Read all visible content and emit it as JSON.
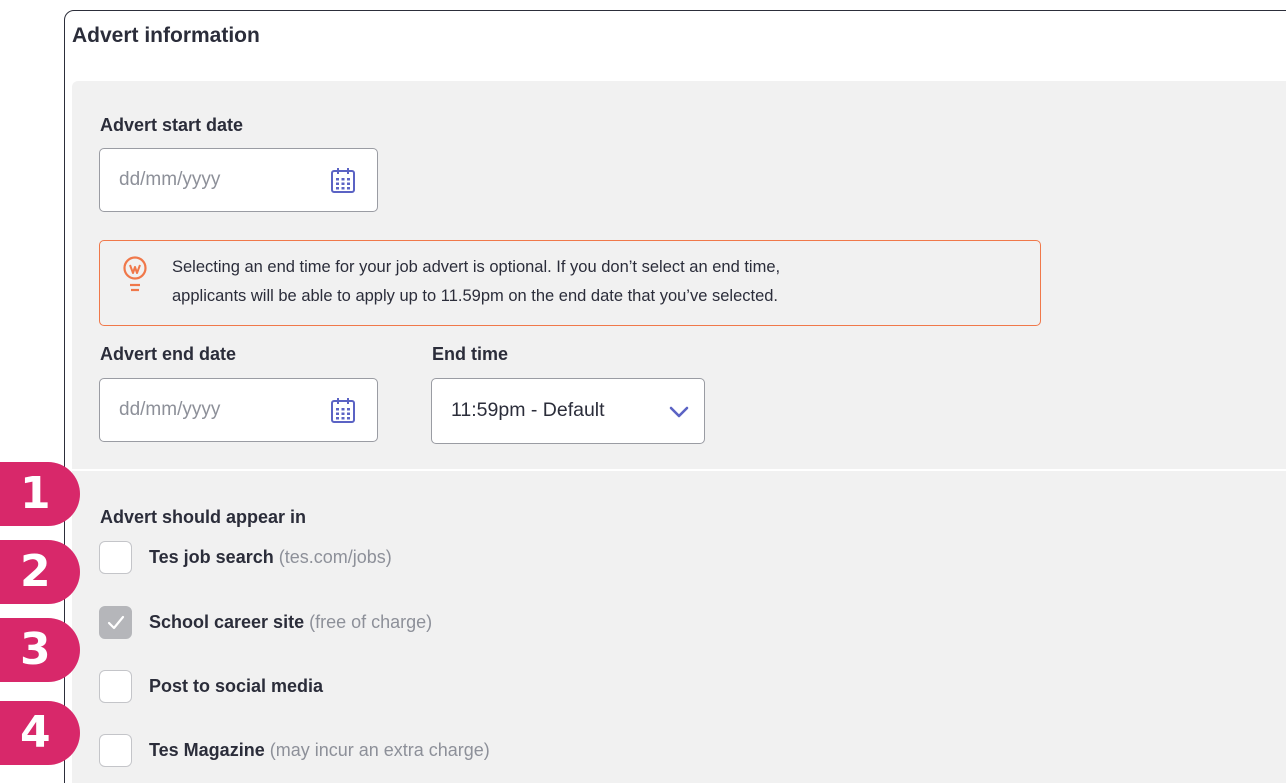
{
  "section": {
    "title": "Advert information"
  },
  "start_date": {
    "label": "Advert start date",
    "placeholder": "dd/mm/yyyy",
    "icon": "calendar-icon"
  },
  "info": {
    "icon": "lightbulb-icon",
    "line1": "Selecting an end time for your job advert is optional. If you don’t select an end time,",
    "line2": "applicants will be able to apply up to 11.59pm on the end date that you’ve selected.",
    "border_color": "#f0784a"
  },
  "end_date": {
    "label": "Advert end date",
    "placeholder": "dd/mm/yyyy",
    "icon": "calendar-icon"
  },
  "end_time": {
    "label": "End time",
    "value": "11:59pm - Default",
    "icon": "chevron-down-icon"
  },
  "appear": {
    "label": "Advert should appear in",
    "options": [
      {
        "label": "Tes job search",
        "note": "(tes.com/jobs)",
        "checked": false
      },
      {
        "label": "School career site",
        "note": "(free of charge)",
        "checked": true
      },
      {
        "label": "Post to social media",
        "note": "",
        "checked": false
      },
      {
        "label": "Tes Magazine",
        "note": "(may incur an extra charge)",
        "checked": false
      }
    ]
  },
  "badges": [
    "1",
    "2",
    "3",
    "4"
  ],
  "colors": {
    "accent": "#5b63c4",
    "badge": "#d8286a",
    "panel": "#f1f1f1"
  }
}
